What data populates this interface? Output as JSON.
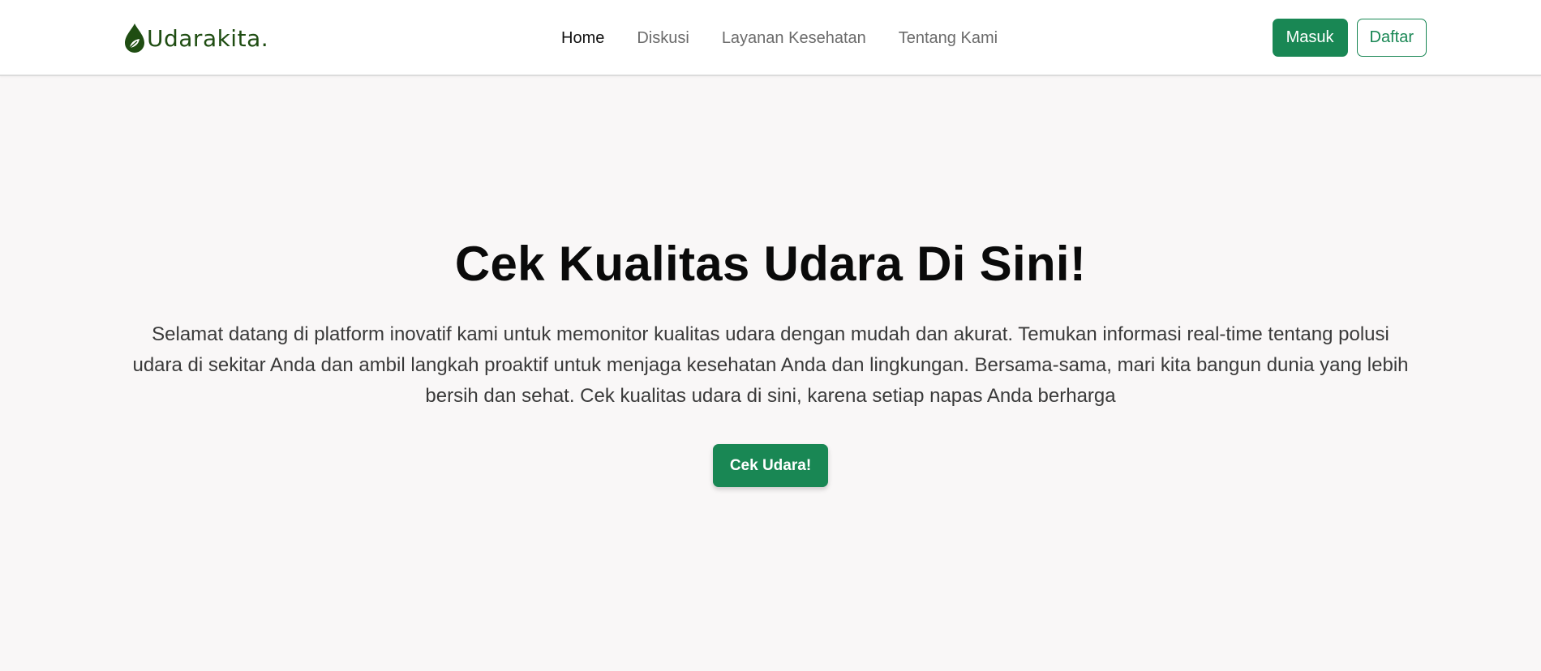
{
  "navbar": {
    "brand": "Udarakita.",
    "links": [
      {
        "label": "Home",
        "active": true
      },
      {
        "label": "Diskusi",
        "active": false
      },
      {
        "label": "Layanan Kesehatan",
        "active": false
      },
      {
        "label": "Tentang Kami",
        "active": false
      }
    ],
    "login_label": "Masuk",
    "register_label": "Daftar"
  },
  "hero": {
    "title": "Cek Kualitas Udara Di Sini!",
    "description": "Selamat datang di platform inovatif kami untuk memonitor kualitas udara dengan mudah dan akurat. Temukan informasi real-time tentang polusi udara di sekitar Anda dan ambil langkah proaktif untuk menjaga kesehatan Anda dan lingkungan. Bersama-sama, mari kita bangun dunia yang lebih bersih dan sehat. Cek kualitas udara di sini, karena setiap napas Anda berharga",
    "cta_label": "Cek Udara!"
  },
  "colors": {
    "primary": "#198754",
    "brand_text": "#1f4d12",
    "background": "#f9f7f7"
  },
  "icons": {
    "brand_logo": "leaf-drop-icon"
  }
}
